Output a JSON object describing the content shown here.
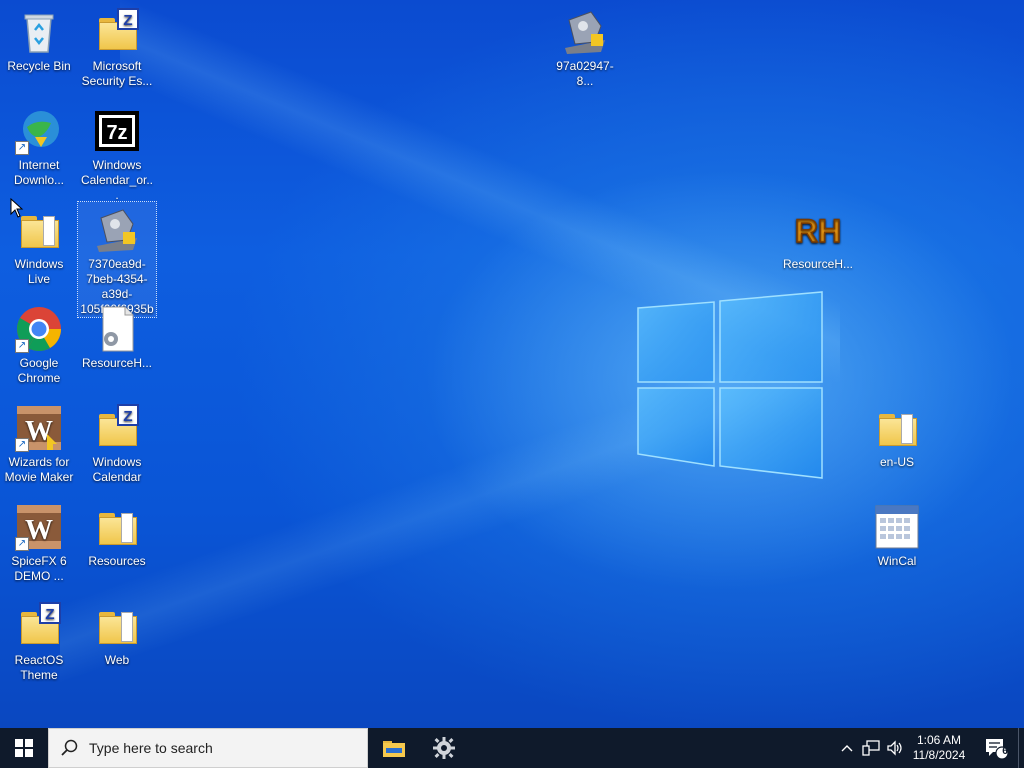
{
  "desktop": {
    "icons": [
      {
        "label": "Recycle Bin"
      },
      {
        "label": "Microsoft Security Es..."
      },
      {
        "label": "Internet Downlo..."
      },
      {
        "label": "Windows Calendar_or..."
      },
      {
        "label": "Windows Live"
      },
      {
        "label": "7370ea9d-7beb-4354-a39d-105f60f6935b"
      },
      {
        "label": "Google Chrome"
      },
      {
        "label": "ResourceH..."
      },
      {
        "label": "Wizards for Movie Maker"
      },
      {
        "label": "Windows Calendar"
      },
      {
        "label": "SpiceFX 6 DEMO ..."
      },
      {
        "label": "Resources"
      },
      {
        "label": "ReactOS Theme"
      },
      {
        "label": "Web"
      },
      {
        "label": "97a02947-8..."
      },
      {
        "label": "ResourceH..."
      },
      {
        "label": "en-US"
      },
      {
        "label": "WinCal"
      }
    ],
    "icon_glyphs": {
      "seven_zip": "7z",
      "resource_hacker": "RH",
      "zip": "Z",
      "wizard": "W"
    }
  },
  "taskbar": {
    "search_placeholder": "Type here to search",
    "clock_time": "1:06 AM",
    "clock_date": "11/8/2024",
    "notification_count": "6",
    "color": "#0f1a2b"
  },
  "colors": {
    "accent": "#1f7de6",
    "folder": "#f0c64b"
  }
}
